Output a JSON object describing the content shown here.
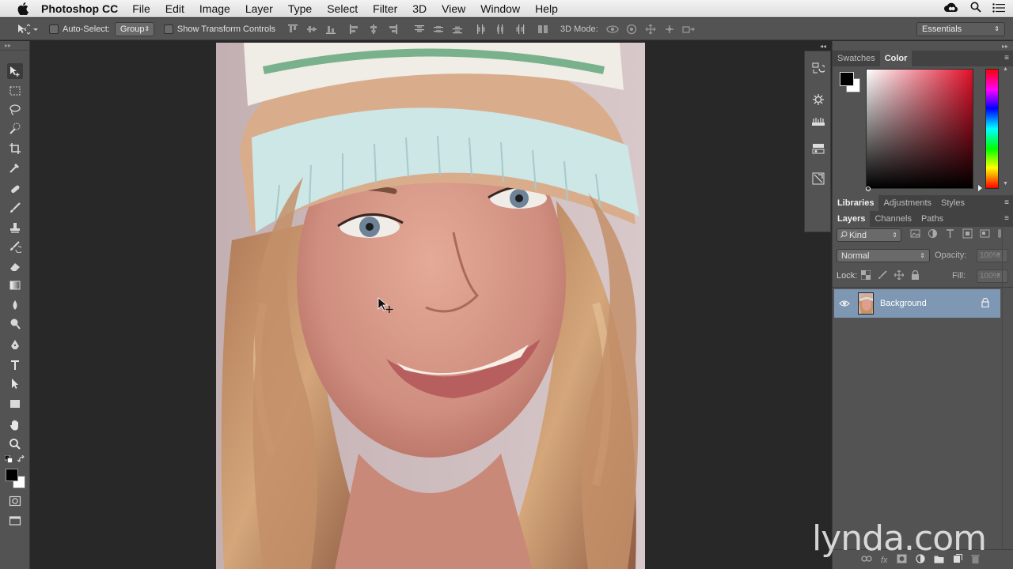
{
  "menubar": {
    "app_name": "Photoshop CC",
    "items": [
      "File",
      "Edit",
      "Image",
      "Layer",
      "Type",
      "Select",
      "Filter",
      "3D",
      "View",
      "Window",
      "Help"
    ]
  },
  "options": {
    "auto_select_label": "Auto-Select:",
    "auto_select_value": "Group",
    "transform_label": "Show Transform Controls",
    "mode_3d_label": "3D Mode:",
    "workspace": "Essentials"
  },
  "color_panel": {
    "tabs": [
      "Swatches",
      "Color"
    ],
    "active_tab": "Color",
    "foreground": "#000000",
    "background": "#ffffff"
  },
  "library_tabs": [
    "Libraries",
    "Adjustments",
    "Styles"
  ],
  "layers_panel": {
    "tabs": [
      "Layers",
      "Channels",
      "Paths"
    ],
    "filter_kind": "Kind",
    "blend_mode": "Normal",
    "opacity_label": "Opacity:",
    "opacity_value": "100%",
    "lock_label": "Lock:",
    "fill_label": "Fill:",
    "fill_value": "100%",
    "layers": [
      {
        "name": "Background",
        "visible": true,
        "locked": true
      }
    ]
  },
  "watermark": "lynda.com",
  "colors": {
    "accent_selection": "#7e98b4",
    "panel": "#535353"
  }
}
